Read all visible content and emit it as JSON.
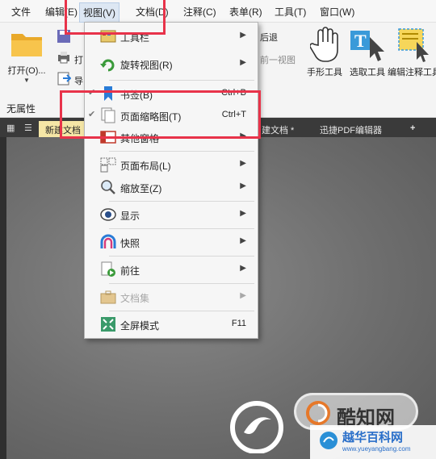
{
  "menubar": {
    "items": [
      "文件",
      "编辑(E)",
      "视图(V)",
      "文档(D)",
      "注释(C)",
      "表单(R)",
      "工具(T)",
      "窗口(W)"
    ]
  },
  "ribbon": {
    "open_label": "打开(O)...",
    "print_label": "打",
    "export_label": "导",
    "back_label": "后退",
    "prev_view_label": "前一视图",
    "hand_tool": "手形工具",
    "select_text": "选取工具",
    "edit_annotation": "编辑注释工具",
    "no_property": "无属性"
  },
  "tabs": [
    "新建文档",
    "建文档 *",
    "迅捷PDF编辑器",
    "+"
  ],
  "view_menu": {
    "items": [
      {
        "label": "工具栏",
        "arrow": "▶"
      },
      {
        "label": "旋转视图(R)",
        "arrow": "▶"
      },
      {
        "label": "书签(B)",
        "shortcut": "Ctrl+B",
        "check": "✔"
      },
      {
        "label": "页面缩略图(T)",
        "shortcut": "Ctrl+T",
        "check": "✔"
      },
      {
        "label": "其他窗格",
        "arrow": "▶"
      },
      {
        "label": "页面布局(L)",
        "arrow": "▶"
      },
      {
        "label": "缩放至(Z)",
        "arrow": "▶"
      },
      {
        "label": "显示",
        "arrow": "▶"
      },
      {
        "label": "快照",
        "arrow": "▶"
      },
      {
        "label": "前往",
        "arrow": "▶"
      },
      {
        "label": "文档集",
        "arrow": "▶"
      },
      {
        "label": "全屏模式",
        "shortcut": "F11"
      }
    ]
  },
  "watermark": {
    "badge_text": "酷知网",
    "banner_text": "越华百科网",
    "banner_url": "www.yueyangbang.com"
  },
  "colors": {
    "highlight_red": "#e8334a",
    "active_tab": "#f5e6a6",
    "menu_bg": "#f6f6f6"
  }
}
